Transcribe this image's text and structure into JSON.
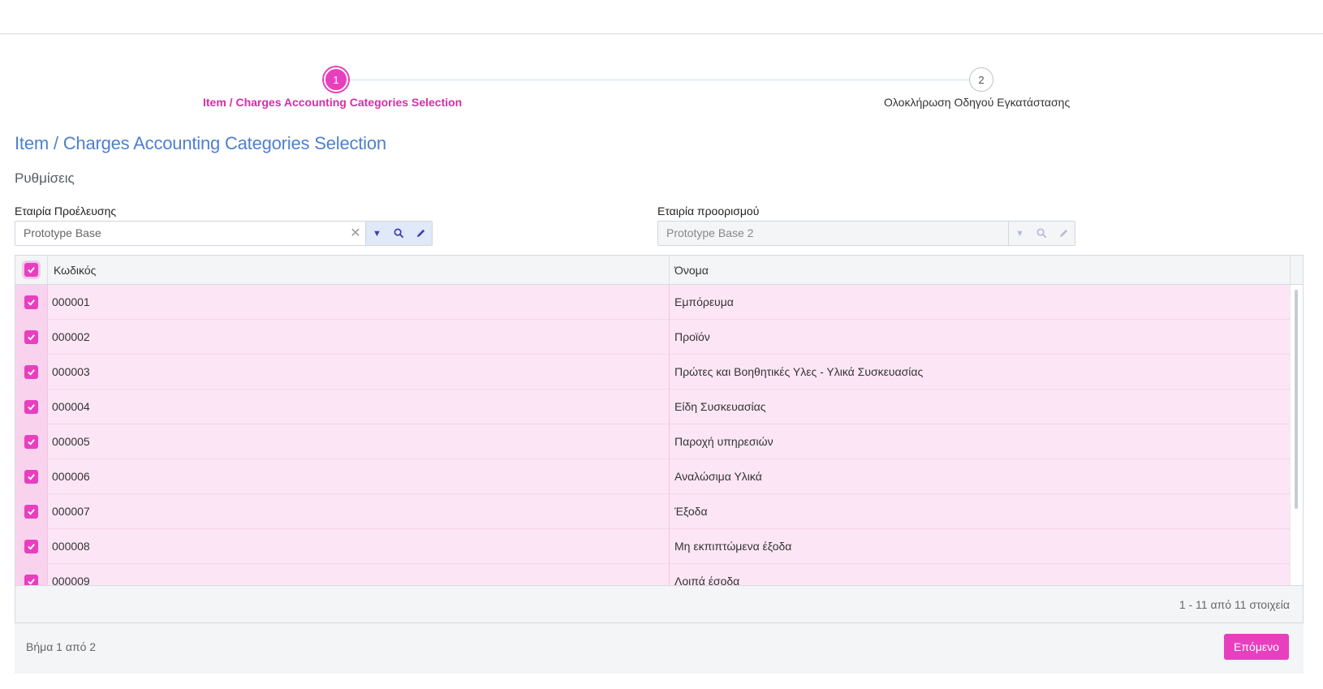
{
  "stepper": {
    "steps": [
      {
        "number": "1",
        "label": "Item / Charges Accounting Categories Selection"
      },
      {
        "number": "2",
        "label": "Ολοκλήρωση Οδηγού Εγκατάστασης"
      }
    ]
  },
  "page": {
    "title": "Item / Charges Accounting Categories Selection",
    "section": "Ρυθμίσεις"
  },
  "fields": {
    "source": {
      "label": "Εταιρία Προέλευσης",
      "value": "Prototype Base"
    },
    "target": {
      "label": "Εταιρία προορισμού",
      "value": "Prototype Base 2"
    }
  },
  "grid": {
    "columns": {
      "code": "Κωδικός",
      "name": "Όνομα"
    },
    "rows": [
      {
        "code": "000001",
        "name": "Εμπόρευμα"
      },
      {
        "code": "000002",
        "name": "Προϊόν"
      },
      {
        "code": "000003",
        "name": "Πρώτες και Βοηθητικές Υλες - Υλικά Συσκευασίας"
      },
      {
        "code": "000004",
        "name": "Είδη Συσκευασίας"
      },
      {
        "code": "000005",
        "name": "Παροχή υπηρεσιών"
      },
      {
        "code": "000006",
        "name": "Αναλώσιμα Υλικά"
      },
      {
        "code": "000007",
        "name": "Έξοδα"
      },
      {
        "code": "000008",
        "name": "Μη εκπιπτώμενα έξοδα"
      },
      {
        "code": "000009",
        "name": "Λοιπά έσοδα"
      }
    ],
    "pager_info": "1 - 11 από 11 στοιχεία"
  },
  "footer": {
    "step_info": "Βήμα 1 από 2",
    "next_label": "Επόμενο"
  },
  "colors": {
    "accent": "#e83fbf",
    "title_blue": "#4f7fce",
    "row_selected": "#fce6f5"
  }
}
